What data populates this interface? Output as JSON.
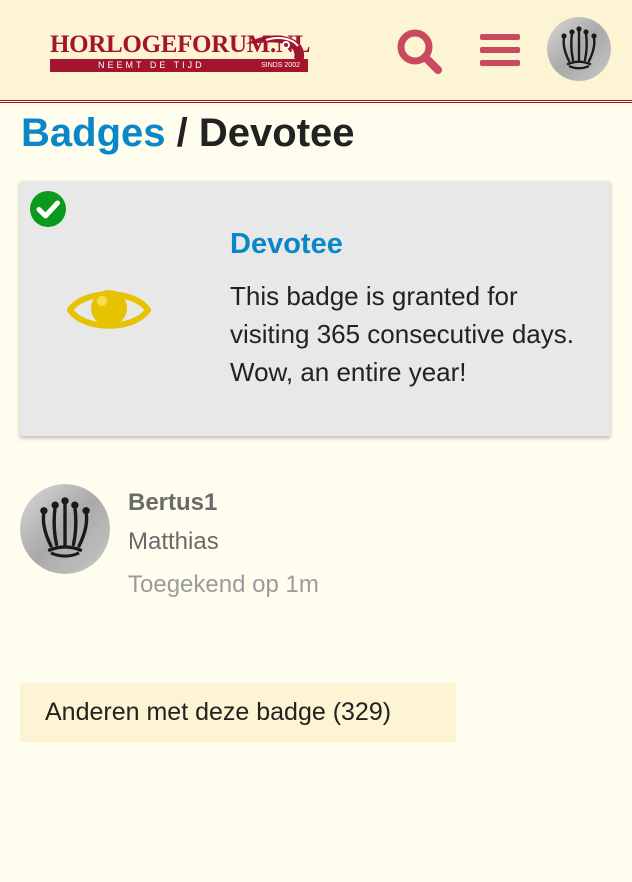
{
  "colors": {
    "page_background": "#fffdee",
    "header_background": "#fdf4d3",
    "brand_red": "#a3142e",
    "header_icon_color": "#c94a5f",
    "link_blue": "#0a87c8",
    "badge_gold": "#e6c200",
    "granted_green": "#0a9b1c",
    "card_background": "#e8e8e8"
  },
  "header": {
    "logo": {
      "name": "HORLOGEFORUM.NL",
      "tagline": "NEEMT DE TIJD",
      "since": "SINDS 2002"
    },
    "icons": [
      "search-icon",
      "hamburger-menu-icon",
      "crown-avatar-icon"
    ]
  },
  "title": {
    "parent_link": "Badges",
    "separator": "/",
    "current": "Devotee"
  },
  "badge": {
    "icon": "eye-icon",
    "status_icon": "check-circle-icon",
    "name": "Devotee",
    "description": "This badge is granted for visiting 365 consecutive days. Wow, an entire year!"
  },
  "granted_user": {
    "username": "Bertus1",
    "full_name": "Matthias",
    "granted_text": "Toegekend op 1m"
  },
  "others_button": {
    "label": "Anderen met deze badge (329)"
  }
}
